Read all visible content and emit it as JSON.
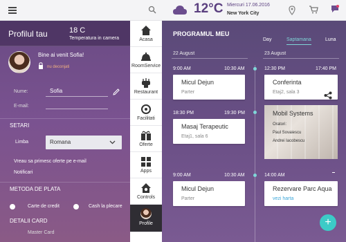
{
  "topbar": {
    "temperature": "12°C",
    "date": "Miercuri 17.06.2016",
    "city": "New York City",
    "icons": [
      "menu-icon",
      "search-icon",
      "cloud-icon",
      "location-pin-icon",
      "cart-icon",
      "chat-icon"
    ]
  },
  "profile": {
    "title": "Profilul tau",
    "room_temp": "18 C",
    "room_temp_label": "Temperatura in camera",
    "welcome": "Bine ai venit Sofia!",
    "logout": "nu deconjati",
    "name_label": "Nume:",
    "name_value": "Sofia",
    "email_label": "E-mail:",
    "email_value": "",
    "settings_heading": "SETARI",
    "language_label": "Limba",
    "language_value": "Romana",
    "offers_text": "Vreau sa primesc oferte pe e-mail",
    "notifications_text": "Notificari",
    "payment_heading": "METODA DE PLATA",
    "payment_card": "Carte de credit",
    "payment_cash": "Cash la plecare",
    "card_details_heading": "DETALII CARD",
    "card_master": "Master Card"
  },
  "nav": {
    "items": [
      {
        "label": "Acasa",
        "icon": "home-icon"
      },
      {
        "label": "RoomService",
        "icon": "room-service-icon"
      },
      {
        "label": "Restaurant",
        "icon": "restaurant-icon"
      },
      {
        "label": "Facilitati",
        "icon": "facilities-icon"
      },
      {
        "label": "Oferte",
        "icon": "offers-icon"
      },
      {
        "label": "Apps",
        "icon": "apps-icon"
      },
      {
        "label": "Controls",
        "icon": "controls-icon"
      },
      {
        "label": "Profile",
        "icon": "profile-avatar"
      }
    ],
    "active": "Profile"
  },
  "program": {
    "title": "PROGRAMUL MEU",
    "tabs": [
      "Day",
      "Saptamana",
      "Luna"
    ],
    "active_tab": "Saptamana",
    "col_left_date": "22 August",
    "col_right_date": "23 August",
    "events": [
      {
        "start": "9:00 AM",
        "end": "10:30 AM",
        "title": "Micul Dejun",
        "sub": "Parter"
      },
      {
        "start": "12:30 PM",
        "end": "17:40 PM",
        "title": "Conferinta",
        "sub": "Etaj2, sala 3"
      },
      {
        "start": "18:30 PM",
        "end": "19:30 PM",
        "title": "Masaj Terapeutic",
        "sub": "Etaj1, sala 6"
      },
      {
        "title": "Mobil Systems",
        "line1": "Oratori:",
        "line2": "Paul Sovaiescu",
        "line3": "Andrei Iacobescu"
      },
      {
        "start": "9:00 AM",
        "end": "10:30 AM",
        "title": "Micul Dejun",
        "sub": "Parter"
      },
      {
        "start": "14:00 AM",
        "title": "Rezervare Parc Aqua",
        "link": "vezi harta"
      }
    ],
    "fab": "+"
  },
  "colors": {
    "accent": "#3ccbc7",
    "topbar_text": "#5a3f7f",
    "logout": "#f0b080"
  }
}
